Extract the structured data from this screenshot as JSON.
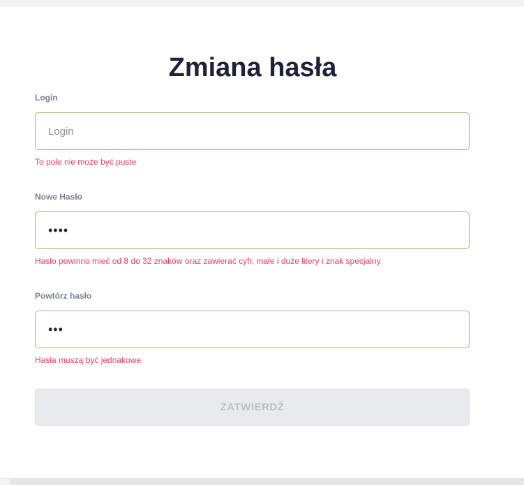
{
  "form": {
    "title": "Zmiana hasła",
    "login": {
      "label": "Login",
      "placeholder": "Login",
      "value": "",
      "error": "To pole nie może być puste"
    },
    "new_password": {
      "label": "Nowe Hasło",
      "value": "abcd",
      "error": "Hasło powinno mieć od 8 do 32 znaków oraz zawierać cyfr, małe i duże litery i znak specjalny"
    },
    "repeat_password": {
      "label": "Powtórz hasło",
      "value": "abc",
      "error": "Hasła muszą być jednakowe"
    },
    "submit_label": "ZATWIERDŹ"
  },
  "colors": {
    "title": "#1e2238",
    "label": "#7b8295",
    "input_border": "#c9a66b",
    "error": "#e8425f",
    "button_bg": "#e8eaee",
    "button_text": "#bcc1ca"
  }
}
